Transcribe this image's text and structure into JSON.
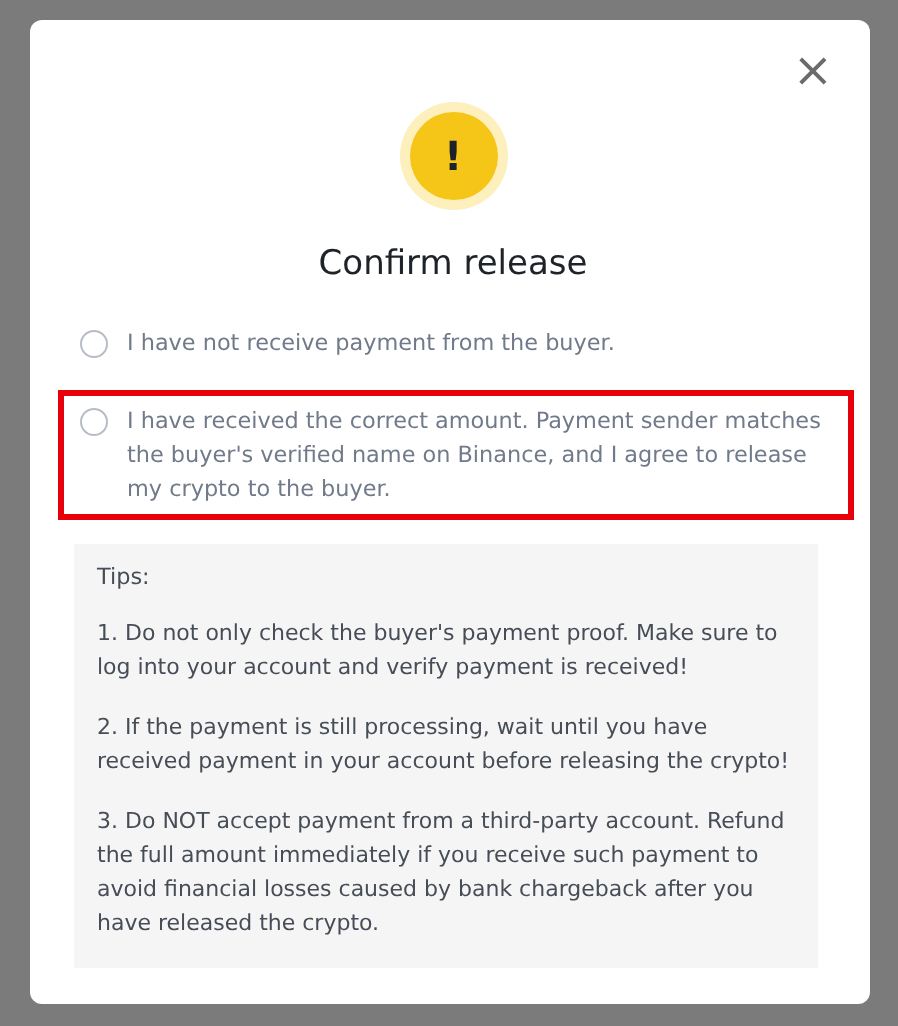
{
  "dialog": {
    "title": "Confirm release",
    "close": "×",
    "icon": "!",
    "options": [
      {
        "label": "I have not receive payment from the buyer.",
        "selected": false,
        "highlighted": false
      },
      {
        "label": "I have received the correct amount. Payment sender matches the buyer's verified name on Binance, and I agree to release my crypto to the buyer.",
        "selected": false,
        "highlighted": true
      }
    ],
    "tips": {
      "title": "Tips:",
      "items": [
        "1. Do not only check the buyer's payment proof. Make sure to log into your account and verify payment is received!",
        "2. If the payment is still processing, wait until you have received payment in your account before releasing the crypto!",
        "3. Do NOT accept payment from a third-party account. Refund the full amount immediately if you receive such payment to avoid financial losses caused by bank chargeback after you have released the crypto."
      ]
    }
  }
}
